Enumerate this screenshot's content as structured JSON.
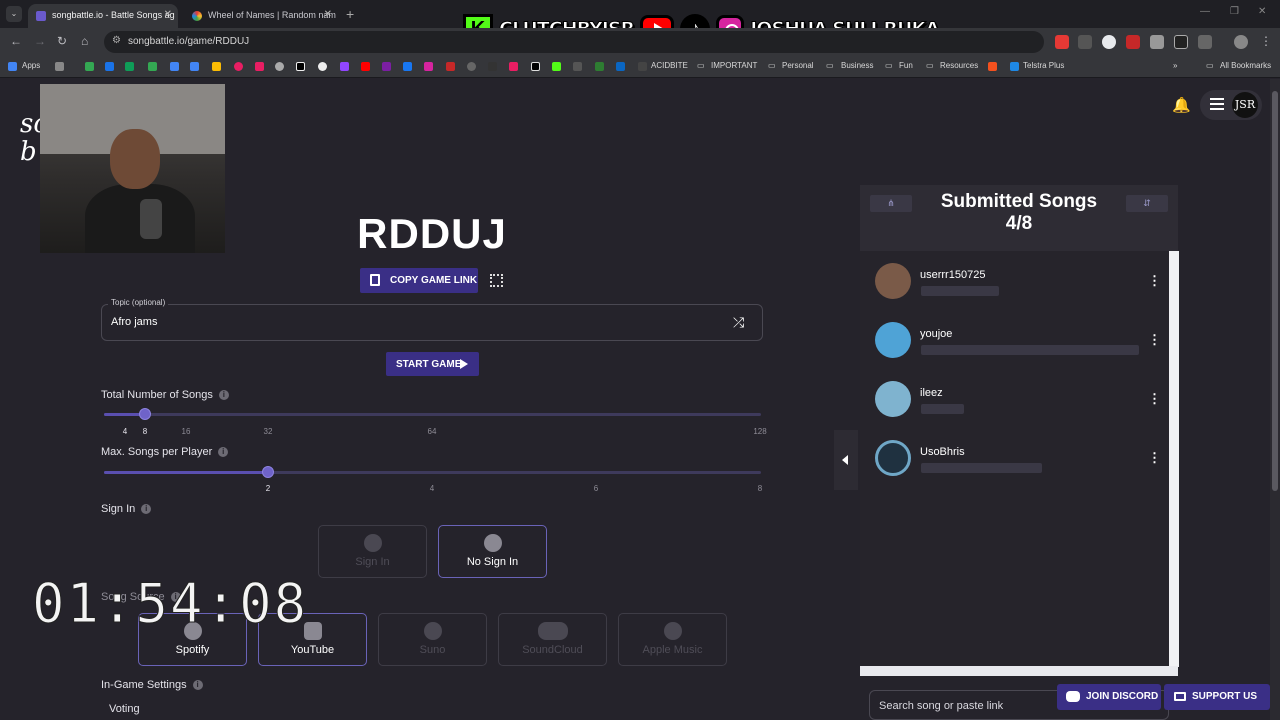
{
  "browser": {
    "tabs": [
      {
        "label": "songbattle.io - Battle Songs ag",
        "active": true
      },
      {
        "label": "Wheel of Names | Random nam",
        "active": false
      }
    ],
    "new_tab": "+",
    "url": "songbattle.io/game/RDDUJ",
    "bookmarks": [
      "Apps",
      "ACIDBITE",
      "IMPORTANT",
      "Personal",
      "Business",
      "Fun",
      "Resources",
      "Telstra Plus",
      "All Bookmarks"
    ]
  },
  "overlay": {
    "kick_handle": "CLUTCHBYJSR",
    "social_handle": "JOSHUA SULI-RUKA",
    "kick_letter": "K",
    "tiktok_glyph": "♪"
  },
  "site": {
    "logo_line1": "sc",
    "logo_line2": "b",
    "avatar_initials": "JSR"
  },
  "game": {
    "code": "RDDUJ",
    "copy_link_label": "COPY GAME LINK",
    "topic_label": "Topic (optional)",
    "topic_value": "Afro jams",
    "start_label": "START GAME",
    "total_songs_label": "Total Number of Songs",
    "total_songs_value": 8,
    "total_songs_ticks": [
      "4",
      "8",
      "16",
      "32",
      "64",
      "128"
    ],
    "max_per_player_label": "Max. Songs per Player",
    "max_per_player_value": 2,
    "max_per_player_ticks": [
      "2",
      "4",
      "6",
      "8"
    ],
    "signin_label": "Sign In",
    "signin_options": [
      {
        "label": "Sign In",
        "selected": false
      },
      {
        "label": "No Sign In",
        "selected": true
      }
    ],
    "song_source_label": "Song Source",
    "sources": [
      {
        "label": "Spotify",
        "selected": true
      },
      {
        "label": "YouTube",
        "selected": true
      },
      {
        "label": "Suno",
        "selected": false
      },
      {
        "label": "SoundCloud",
        "selected": false
      },
      {
        "label": "Apple Music",
        "selected": false
      }
    ],
    "in_game_label": "In-Game Settings",
    "voting_label": "Voting"
  },
  "timer": "01:54:08",
  "submitted": {
    "title": "Submitted Songs",
    "count": "4/8",
    "players": [
      {
        "name": "userrr150725",
        "avatar_color": "#7a5a48"
      },
      {
        "name": "youjoe",
        "avatar_color": "#4fa3d6"
      },
      {
        "name": "ileez",
        "avatar_color": "#7fb3cf"
      },
      {
        "name": "UsoBhris",
        "avatar_color": "#1f3140"
      }
    ]
  },
  "footer": {
    "search_placeholder": "Search song or paste link",
    "discord_label": "JOIN DISCORD",
    "support_label": "SUPPORT US"
  }
}
